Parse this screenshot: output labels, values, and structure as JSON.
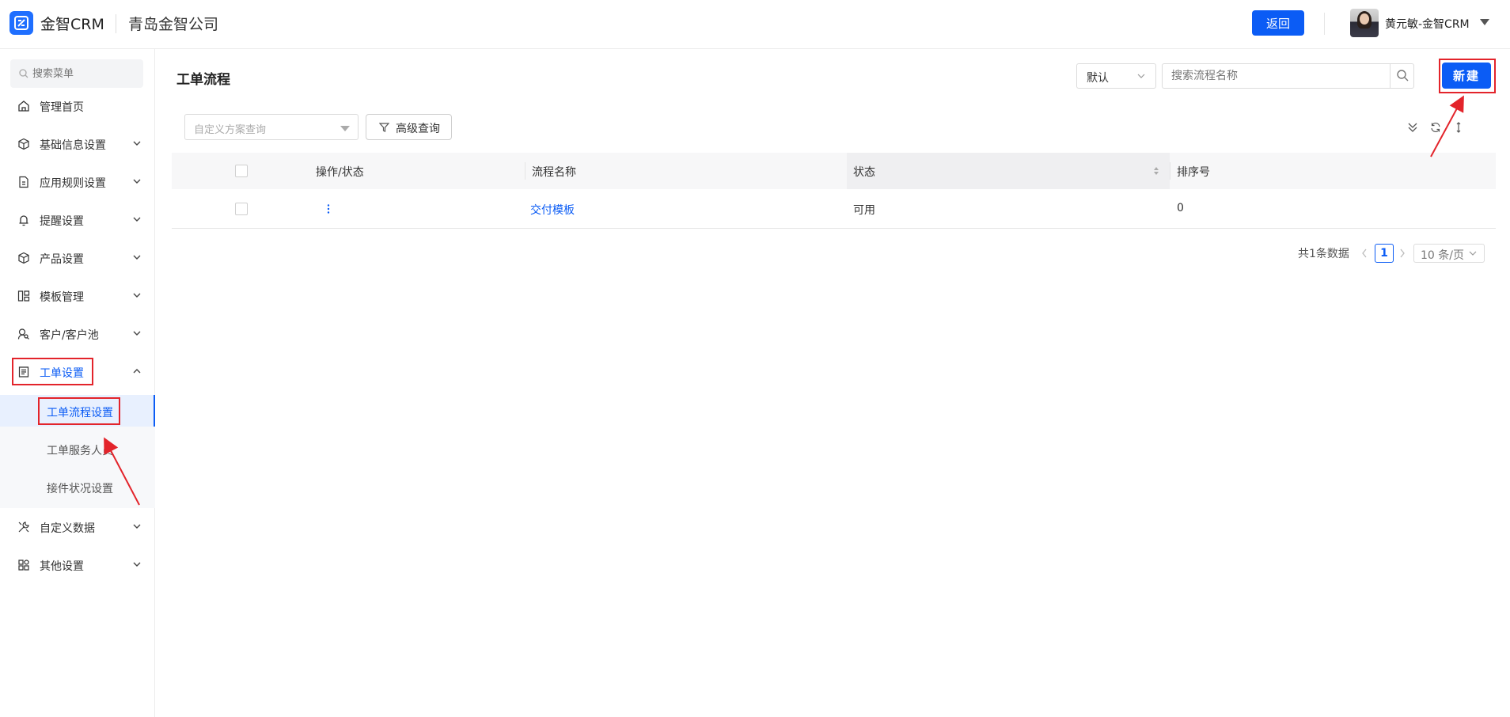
{
  "header": {
    "logo_text": "金智CRM",
    "company": "青岛金智公司",
    "back_label": "返回",
    "user_name": "黄元敏-金智CRM"
  },
  "sidebar": {
    "search_placeholder": "搜索菜单",
    "items": [
      {
        "label": "管理首页",
        "icon": "home-icon"
      },
      {
        "label": "基础信息设置",
        "icon": "cube-icon"
      },
      {
        "label": "应用规则设置",
        "icon": "document-icon"
      },
      {
        "label": "提醒设置",
        "icon": "bell-icon"
      },
      {
        "label": "产品设置",
        "icon": "box-icon"
      },
      {
        "label": "模板管理",
        "icon": "template-icon"
      },
      {
        "label": "客户/客户池",
        "icon": "user-search-icon"
      },
      {
        "label": "工单设置",
        "icon": "ticket-icon"
      },
      {
        "label": "自定义数据",
        "icon": "tools-icon"
      },
      {
        "label": "其他设置",
        "icon": "apps-icon"
      }
    ],
    "submenu": [
      {
        "label": "工单流程设置"
      },
      {
        "label": "工单服务人员"
      },
      {
        "label": "接件状况设置"
      }
    ]
  },
  "main": {
    "title": "工单流程",
    "default_select": "默认",
    "search_placeholder": "搜索流程名称",
    "new_label": "新建",
    "scheme_placeholder": "自定义方案查询",
    "advanced_label": "高级查询",
    "table": {
      "columns": [
        "操作/状态",
        "流程名称",
        "状态",
        "排序号"
      ],
      "rows": [
        {
          "name": "交付模板",
          "status": "可用",
          "order": "0"
        }
      ]
    },
    "pagination": {
      "total": "共1条数据",
      "current": "1",
      "page_size": "10 条/页"
    }
  },
  "colors": {
    "primary": "#0b5cf5",
    "annotation": "#e3242b"
  }
}
